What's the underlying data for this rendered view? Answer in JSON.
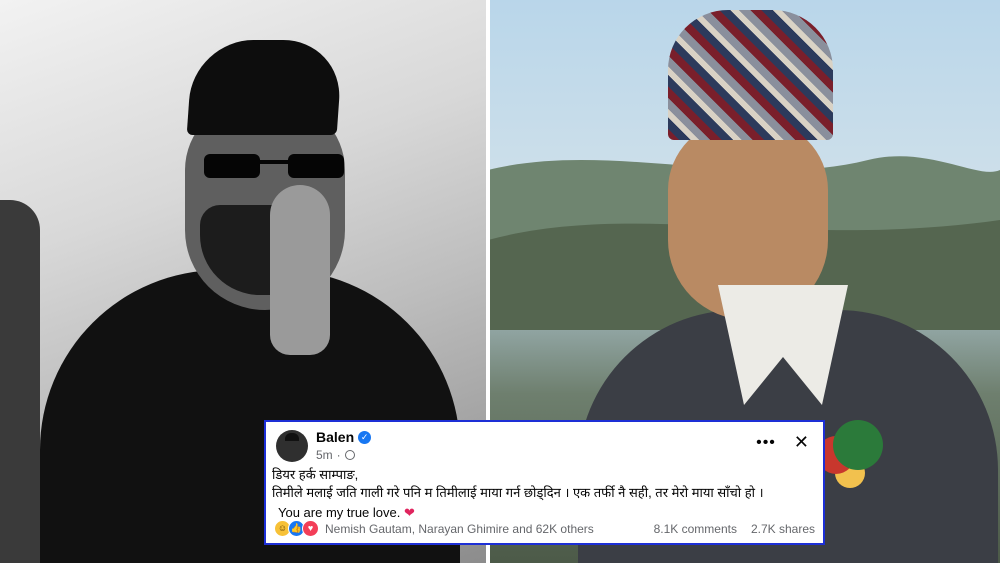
{
  "post": {
    "author": "Balen",
    "time": "5m",
    "line1": "डियर हर्क साम्पाङ,",
    "line2": "तिमीले मलाई जति गाली गरे पनि म तिमीलाई माया गर्न छोड्दिन । एक तर्फी नै सही, तर मेरो माया साँचो हो ।",
    "line3": "You are my true love.",
    "heart": "❤",
    "more_glyph": "•••",
    "close_glyph": "✕",
    "reacted_by": "Nemish Gautam, Narayan Ghimire and 62K others",
    "comments": "8.1K comments",
    "shares": "2.7K shares",
    "reaction_icons": [
      "haha-icon",
      "like-icon",
      "love-icon"
    ]
  },
  "colors": {
    "card_border": "#1d2fd6",
    "verified": "#1877f2",
    "heart": "#e0245e"
  }
}
